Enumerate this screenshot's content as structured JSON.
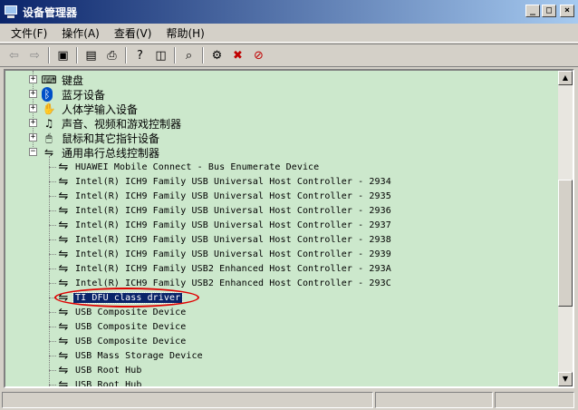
{
  "window": {
    "title": "设备管理器",
    "minimize": "_",
    "maximize": "□",
    "close": "×"
  },
  "menu": [
    "文件(F)",
    "操作(A)",
    "查看(V)",
    "帮助(H)"
  ],
  "toolbar": [
    {
      "icon": "back-arrow-icon",
      "glyph": "⇦"
    },
    {
      "icon": "forward-arrow-icon",
      "glyph": "⇨"
    },
    {
      "icon": "show-hide-tree-icon",
      "glyph": "▣"
    },
    {
      "icon": "properties-icon",
      "glyph": "▤"
    },
    {
      "icon": "print-icon",
      "glyph": "⎙"
    },
    {
      "icon": "help-icon",
      "glyph": "?"
    },
    {
      "icon": "console-tree-icon",
      "glyph": "◫"
    },
    {
      "icon": "scan-hardware-icon",
      "glyph": "⌕"
    },
    {
      "icon": "update-driver-icon",
      "glyph": "⚙"
    },
    {
      "icon": "uninstall-icon",
      "glyph": "✖"
    },
    {
      "icon": "disable-device-icon",
      "glyph": "⊘"
    }
  ],
  "tree": {
    "categories": [
      {
        "label": "键盘",
        "icon": "keyboard-icon",
        "glyph": "⌨",
        "expanded": false
      },
      {
        "label": "蓝牙设备",
        "icon": "bluetooth-icon",
        "glyph": "ᛒ",
        "expanded": false
      },
      {
        "label": "人体学输入设备",
        "icon": "hid-icon",
        "glyph": "✋",
        "expanded": false
      },
      {
        "label": "声音、视频和游戏控制器",
        "icon": "sound-icon",
        "glyph": "♫",
        "expanded": false
      },
      {
        "label": "鼠标和其它指针设备",
        "icon": "mouse-icon",
        "glyph": "🖱",
        "expanded": false
      },
      {
        "label": "通用串行总线控制器",
        "icon": "usb-icon",
        "glyph": "⇋",
        "expanded": true
      }
    ],
    "devices": [
      "HUAWEI Mobile Connect - Bus Enumerate Device",
      "Intel(R) ICH9 Family USB Universal Host Controller - 2934",
      "Intel(R) ICH9 Family USB Universal Host Controller - 2935",
      "Intel(R) ICH9 Family USB Universal Host Controller - 2936",
      "Intel(R) ICH9 Family USB Universal Host Controller - 2937",
      "Intel(R) ICH9 Family USB Universal Host Controller - 2938",
      "Intel(R) ICH9 Family USB Universal Host Controller - 2939",
      "Intel(R) ICH9 Family USB2 Enhanced Host Controller - 293A",
      "Intel(R) ICH9 Family USB2 Enhanced Host Controller - 293C",
      "TI DFU class driver",
      "USB Composite Device",
      "USB Composite Device",
      "USB Composite Device",
      "USB Mass Storage Device",
      "USB Root Hub",
      "USB Root Hub"
    ],
    "selected_device": "TI DFU class driver"
  },
  "colors": {
    "tree_background": "#cce8cc",
    "selection": "#0a246a",
    "highlight_ellipse": "#e00000"
  }
}
